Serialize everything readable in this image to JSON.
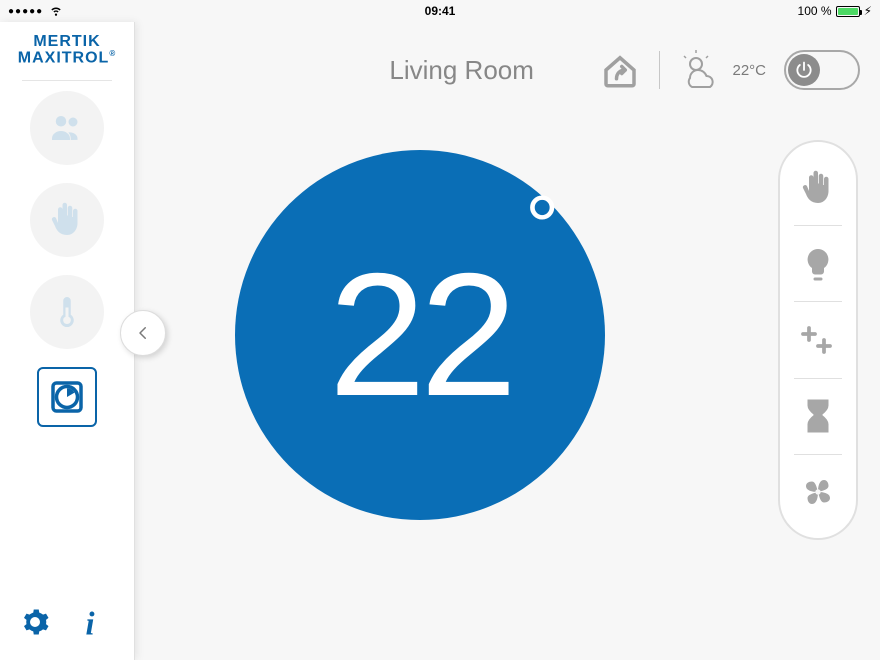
{
  "statusbar": {
    "signal_dots": "●●●●●",
    "time": "09:41",
    "battery_pct": "100 %"
  },
  "brand": {
    "line1": "MERTIK",
    "line2": "MAXITROL"
  },
  "sidebar": {
    "items": [
      {
        "name": "users",
        "icon": "users-icon"
      },
      {
        "name": "manual",
        "icon": "hand-icon"
      },
      {
        "name": "temp",
        "icon": "thermometer-icon"
      },
      {
        "name": "timer",
        "icon": "clock-icon",
        "active": true
      }
    ]
  },
  "header": {
    "room_title": "Living Room",
    "weather_temp": "22°C"
  },
  "dial": {
    "value": "22",
    "degree": "°"
  },
  "rightpanel": {
    "items": [
      {
        "name": "manual",
        "icon": "hand-icon"
      },
      {
        "name": "light",
        "icon": "bulb-icon"
      },
      {
        "name": "aux",
        "icon": "plus-icon"
      },
      {
        "name": "timer2",
        "icon": "hourglass-icon"
      },
      {
        "name": "fan",
        "icon": "fan-icon"
      }
    ]
  }
}
